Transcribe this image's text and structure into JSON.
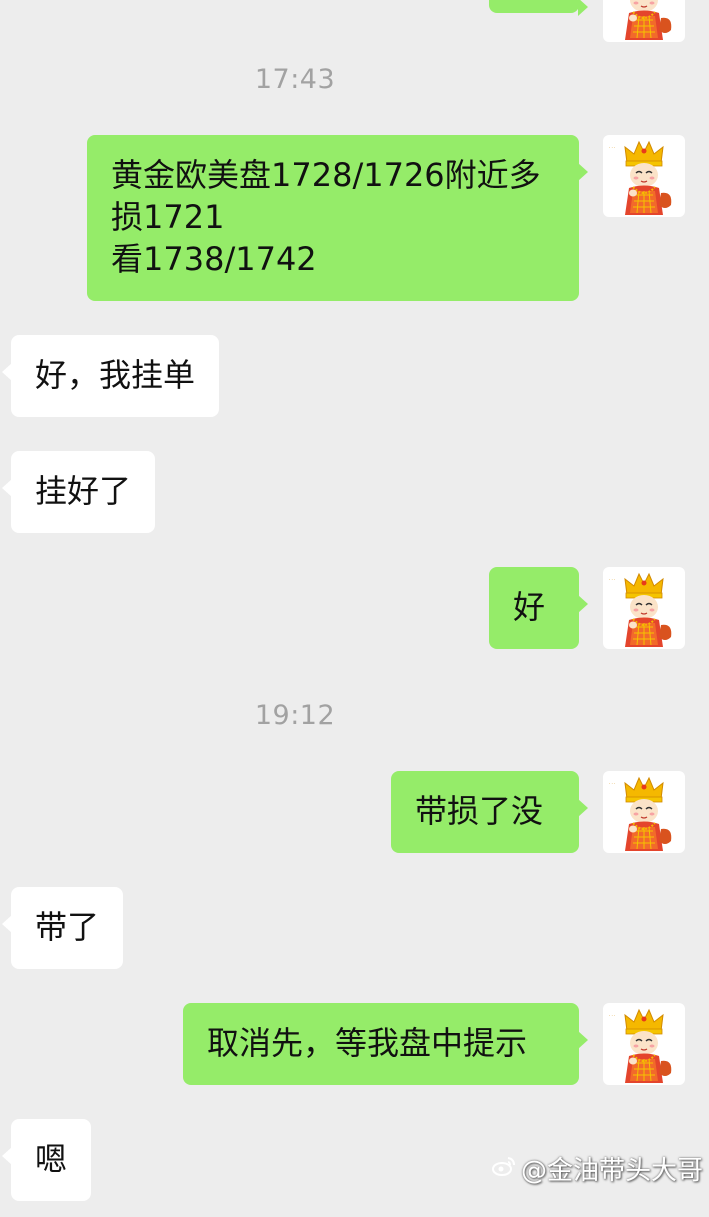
{
  "timestamps": [
    "17:43",
    "19:12"
  ],
  "messages": [
    {
      "side": "out",
      "lines": [
        "黄金欧美盘1728/1726附近多",
        "损1721",
        "看1738/1742"
      ]
    },
    {
      "side": "in",
      "lines": [
        "好，我挂单"
      ]
    },
    {
      "side": "in",
      "lines": [
        "挂好了"
      ]
    },
    {
      "side": "out",
      "lines": [
        "好"
      ]
    },
    {
      "side": "out",
      "lines": [
        "带损了没"
      ]
    },
    {
      "side": "in",
      "lines": [
        "带了"
      ]
    },
    {
      "side": "out",
      "lines": [
        "取消先，等我盘中提示"
      ]
    },
    {
      "side": "in",
      "lines": [
        "嗯"
      ]
    }
  ],
  "watermark": {
    "text": "@金油带头大哥",
    "icon": "weibo-logo-icon"
  },
  "colors": {
    "background": "#ededed",
    "outgoing_bubble": "#95ec69",
    "incoming_bubble": "#ffffff",
    "timestamp_text": "#a2a2a2"
  }
}
